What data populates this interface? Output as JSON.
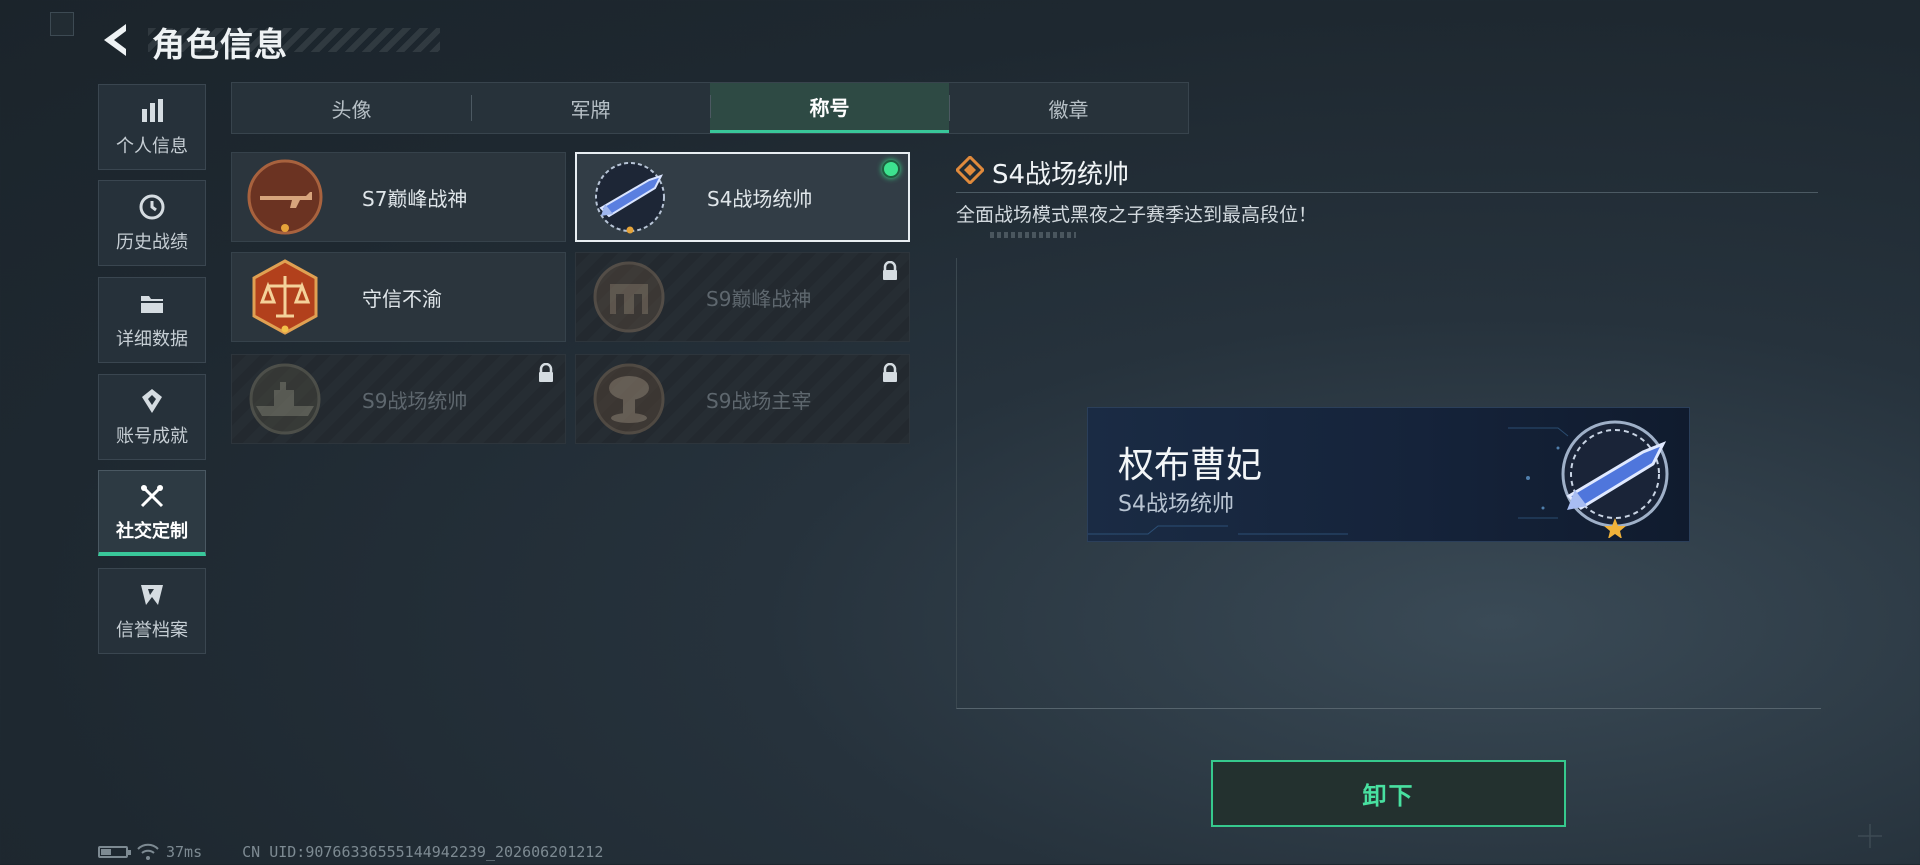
{
  "header": {
    "title": "角色信息"
  },
  "sidebar": {
    "items": [
      {
        "label": "个人信息",
        "icon": "bar-chart-icon"
      },
      {
        "label": "历史战绩",
        "icon": "clock-icon"
      },
      {
        "label": "详细数据",
        "icon": "folder-icon"
      },
      {
        "label": "账号成就",
        "icon": "medal-icon"
      },
      {
        "label": "社交定制",
        "icon": "tools-icon",
        "active": true
      },
      {
        "label": "信誉档案",
        "icon": "shield-icon"
      }
    ]
  },
  "tabs": [
    {
      "label": "头像"
    },
    {
      "label": "军牌"
    },
    {
      "label": "称号",
      "active": true
    },
    {
      "label": "徽章"
    }
  ],
  "titles": [
    {
      "name": "S7巅峰战神",
      "emblem": "rifle-emblem",
      "locked": false
    },
    {
      "name": "S4战场统帅",
      "emblem": "missile-emblem",
      "locked": false,
      "selected": true,
      "equipped": true
    },
    {
      "name": "守信不渝",
      "emblem": "scales-emblem",
      "locked": false
    },
    {
      "name": "S9巅峰战神",
      "emblem": "fortress-emblem",
      "locked": true
    },
    {
      "name": "S9战场统帅",
      "emblem": "warship-emblem",
      "locked": true
    },
    {
      "name": "S9战场主宰",
      "emblem": "mushroom-cloud-emblem",
      "locked": true
    }
  ],
  "detail": {
    "title": "S4战场统帅",
    "description": "全面战场模式黑夜之子赛季达到最高段位！"
  },
  "banner": {
    "player_name": "权布曹妃",
    "title": "S4战场统帅"
  },
  "actions": {
    "unequip_label": "卸下"
  },
  "status": {
    "ping": "37ms",
    "uid": "CN UID:90766336555144942239_202606201212"
  },
  "colors": {
    "accent": "#39c79a",
    "equipped": "#3de38f",
    "detail_icon": "#e08a3c"
  }
}
